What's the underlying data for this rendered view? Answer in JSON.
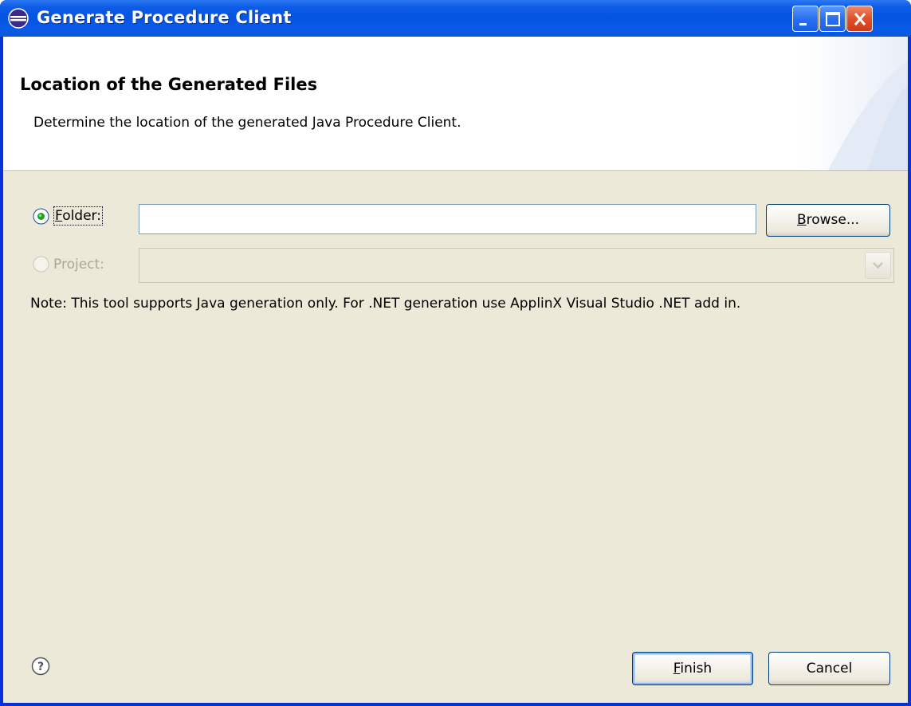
{
  "window": {
    "title": "Generate Procedure Client",
    "icon": "eclipse-icon"
  },
  "banner": {
    "title": "Location of the Generated Files",
    "description": "Determine the location of the generated Java Procedure Client."
  },
  "form": {
    "folder": {
      "label": "Folder:",
      "mnemonic": "F",
      "rest": "older:",
      "selected": true,
      "value": ""
    },
    "project": {
      "label": "Project:",
      "selected": false,
      "enabled": false,
      "value": ""
    },
    "browse": {
      "label": "Browse...",
      "mnemonic": "B",
      "rest": "rowse..."
    },
    "note": "Note: This tool supports Java generation only. For .NET generation use ApplinX Visual Studio .NET add in."
  },
  "footer": {
    "help_icon": "help-icon",
    "finish": {
      "label": "Finish",
      "mnemonic": "F",
      "rest": "inish"
    },
    "cancel": {
      "label": "Cancel"
    }
  },
  "colors": {
    "titlebar": "#0553e1",
    "dialog_bg": "#ece9d8",
    "banner_bg": "#ffffff",
    "button_border": "#003c74",
    "disabled_text": "#aca899"
  }
}
